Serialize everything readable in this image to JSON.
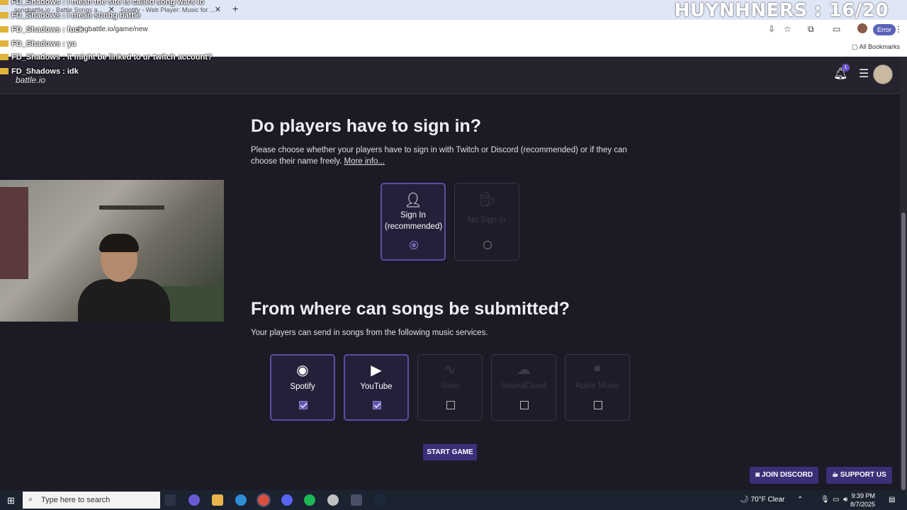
{
  "browser": {
    "tabs": [
      {
        "label": "songbattle.io - Battle Songs a...",
        "close": "✕"
      },
      {
        "label": "Spotify - Web Player: Music for ...",
        "close": "✕"
      }
    ],
    "new_tab": "+",
    "url": "ongbattle.io/game/new",
    "error_label": "Error",
    "all_bookmarks": "All Bookmarks"
  },
  "overlay": {
    "title": "HUYNHNERS : 16/20",
    "chat": [
      {
        "user": "FD_Shadows",
        "msg": "i mean the site is called song wars io"
      },
      {
        "user": "FD_Shadows",
        "msg": "i mean sonbg battle"
      },
      {
        "user": "FD_Shadows",
        "msg": "fuck"
      },
      {
        "user": "FD_Shadows",
        "msg": "ya"
      },
      {
        "user": "FD_Shadows",
        "msg": "it might be linked to ur twitch account?"
      },
      {
        "user": "FD_Shadows",
        "msg": "idk"
      }
    ]
  },
  "site": {
    "logo": "battle.io",
    "notif_count": "1"
  },
  "signin": {
    "title": "Do players have to sign in?",
    "desc": "Please choose whether your players have to sign in with Twitch or Discord (recommended) or if they can choose their name freely.",
    "more": "More info...",
    "options": [
      {
        "label": "Sign In (recommended)",
        "selected": true
      },
      {
        "label": "No Sign In",
        "selected": false
      }
    ]
  },
  "sources": {
    "title": "From where can songs be submitted?",
    "desc": "Your players can send in songs from the following music services.",
    "options": [
      {
        "label": "Spotify",
        "icon": "spotify-icon",
        "checked": true,
        "enabled": true
      },
      {
        "label": "YouTube",
        "icon": "youtube-icon",
        "checked": true,
        "enabled": true
      },
      {
        "label": "Suno",
        "icon": "suno-icon",
        "checked": false,
        "enabled": false
      },
      {
        "label": "SoundCloud",
        "icon": "soundcloud-icon",
        "checked": false,
        "enabled": false
      },
      {
        "label": "Apple Music",
        "icon": "apple-music-icon",
        "checked": false,
        "enabled": false
      }
    ]
  },
  "start_button": "START GAME",
  "footer": {
    "discord": "JOIN DISCORD",
    "support": "SUPPORT US"
  },
  "taskbar": {
    "search_placeholder": "Type here to search",
    "weather": "70°F  Clear",
    "time": "9:39 PM",
    "date": "8/7/2025"
  },
  "colors": {
    "background": "#1c1a25",
    "accent": "#5b4fa6",
    "button": "#3b2f7a"
  }
}
